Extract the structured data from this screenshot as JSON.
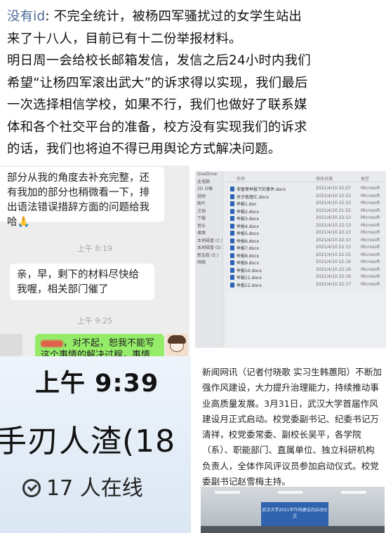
{
  "post": {
    "author": "没有id",
    "sep": ": ",
    "line1_rest": "不完全统计，被杨四军骚扰过的女学生站出",
    "line2": "来了十八人，目前已有十二份举报材料。",
    "line3": "明日周一会给校长邮箱发信，发信之后24小时内我们",
    "line4": "希望“让杨四军滚出武大”的诉求得以实现，我们最后",
    "line5": "一次选择相信学校，如果不行，我们也做好了联系媒",
    "line6": "体和各个社交平台的准备，校方没有实现我们的诉求",
    "line7": "的话，我们也将迫不得已用舆论方式解决问题。"
  },
  "chat": {
    "msg1": "部分从我的角度去补充完整，还有我加的部分也稍微看一下，排出语法错误措辞方面的问题给我哈🙏",
    "time1": "上午 8:19",
    "msg2": "亲，早，剩下的材料尽快给我喔，相关部门催了",
    "time2": "上午 9:25",
    "msg3": "，对不起，恕我不能写这个事情的解决过程，事情车"
  },
  "explorer": {
    "nav_items": [
      "OneDrive",
      "此电脑",
      "3D 对象",
      "视频",
      "图片",
      "文档",
      "下载",
      "音乐",
      "桌面",
      "本地磁盘 (C:)",
      "本地磁盘 (D:)",
      "新加卷 (E:)",
      "网络"
    ],
    "col_name": "名称",
    "col_date": "修改日期",
    "col_type": "类型",
    "files": [
      {
        "name": "非暂寄举报下的事件.docx",
        "date": "2021/4/10 22:27",
        "type": "Microsoft"
      },
      {
        "name": "关于梳理汇.docx",
        "date": "2021/4/10 22:13",
        "type": "Microsoft"
      },
      {
        "name": "举报1.doc",
        "date": "2021/4/10 22:13",
        "type": "Microsoft"
      },
      {
        "name": "举报2.docx",
        "date": "2021/4/10 21:52",
        "type": "Microsoft"
      },
      {
        "name": "举报3.docx",
        "date": "2021/4/10 22:13",
        "type": "Microsoft"
      },
      {
        "name": "举报4.docx",
        "date": "2021/4/10 22:13",
        "type": "Microsoft"
      },
      {
        "name": "举报5.docx",
        "date": "2021/4/10 22:13",
        "type": "Microsoft"
      },
      {
        "name": "举报6.docx",
        "date": "2021/4/10 22:13",
        "type": "Microsoft"
      },
      {
        "name": "举报7.docx",
        "date": "2021/4/10 22:13",
        "type": "Microsoft"
      },
      {
        "name": "举报8.docx",
        "date": "2021/4/10 22:15",
        "type": "Microsoft"
      },
      {
        "name": "举报9.docx",
        "date": "2021/4/10 22:16",
        "type": "Microsoft"
      },
      {
        "name": "举报10.docx",
        "date": "2021/4/10 22:16",
        "type": "Microsoft"
      },
      {
        "name": "举报11.docx",
        "date": "2021/4/10 22:16",
        "type": "Microsoft"
      },
      {
        "name": "举报12.docx",
        "date": "2021/4/10 22:17",
        "type": "Microsoft"
      }
    ]
  },
  "bigtime": {
    "clock": "上午 9:39",
    "group_name": "手刃人渣(18",
    "online": "17 人在线"
  },
  "news": {
    "paragraph": "新闻网讯（记者付晓歌 实习生韩蕙阳）不断加强作风建设，大力提升治理能力，持续推动事业高质量发展。3月31日，武汉大学首届作风建设月正式启动。校党委副书记、纪委书记万清祥，校党委常委、副校长吴平，各学院（系）、职能部门、直属单位、独立科研机构负责人，全体作风评议员参加启动仪式。校党委副书记赵雪梅主持。",
    "screen_text": "武汉大学2021年作风建设月启动仪式"
  }
}
